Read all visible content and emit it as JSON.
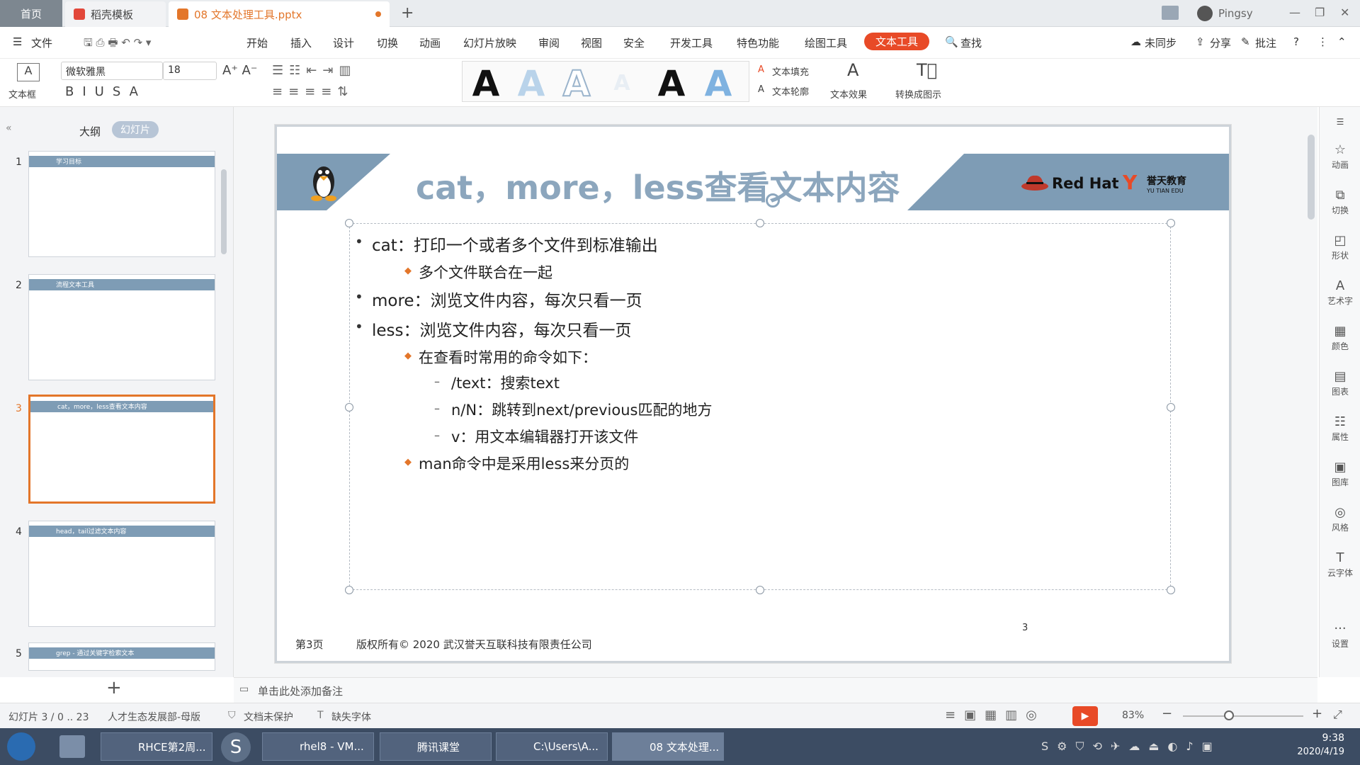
{
  "tabs": {
    "home": "首页",
    "template": "稻壳模板",
    "doc": "08 文本处理工具.pptx"
  },
  "user": "Pingsy",
  "menu": {
    "file": "文件",
    "items": [
      "开始",
      "插入",
      "设计",
      "切换",
      "动画",
      "幻灯片放映",
      "审阅",
      "视图",
      "安全",
      "开发工具",
      "特色功能",
      "绘图工具",
      "文本工具"
    ],
    "search": "查找",
    "sync": "未同步",
    "share": "分享",
    "comment": "批注"
  },
  "ribbon": {
    "textbox": "文本框",
    "font": "微软雅黑",
    "size": "18",
    "fill": "文本填充",
    "outline": "文本轮廓",
    "effect": "文本效果",
    "convert": "转换成图示",
    "artA": "A"
  },
  "panel": {
    "outline": "大纲",
    "slides": "幻灯片",
    "add": "+"
  },
  "thumbs": [
    {
      "n": "1",
      "title": "学习目标"
    },
    {
      "n": "2",
      "title": "流程文本工具"
    },
    {
      "n": "3",
      "title": "cat，more，less查看文本内容"
    },
    {
      "n": "4",
      "title": "head，tail过滤文本内容"
    },
    {
      "n": "5",
      "title": "grep - 通过关键字检索文本"
    }
  ],
  "slide": {
    "title": "cat，more，less查看文本内容",
    "brand": "Red Hat",
    "school": "誉天教育",
    "school_en": "YU TIAN EDU",
    "bullets": [
      {
        "level": 1,
        "text": "cat：打印一个或者多个文件到标准输出"
      },
      {
        "level": 2,
        "text": "多个文件联合在一起"
      },
      {
        "level": 1,
        "text": "more：浏览文件内容，每次只看一页"
      },
      {
        "level": 1,
        "text": "less：浏览文件内容，每次只看一页"
      },
      {
        "level": 2,
        "text": "在查看时常用的命令如下："
      },
      {
        "level": 3,
        "text": "/text：搜索text"
      },
      {
        "level": 3,
        "text": "n/N：跳转到next/previous匹配的地方"
      },
      {
        "level": 3,
        "text": "v：用文本编辑器打开该文件"
      },
      {
        "level": 2,
        "text": "man命令中是采用less来分页的"
      }
    ],
    "page_label": "第3页",
    "copyright": "版权所有© 2020 武汉誉天互联科技有限责任公司",
    "page_num": "3"
  },
  "notes": "单击此处添加备注",
  "status": {
    "slide": "幻灯片 3 / 0 .. 23",
    "theme": "人才生态发展部-母版",
    "protect": "文档未保护",
    "font": "缺失字体",
    "zoom": "83%"
  },
  "sidebar": [
    "动画",
    "切换",
    "形状",
    "艺术字",
    "颜色",
    "图表",
    "属性",
    "图库",
    "风格",
    "云字体",
    "设置"
  ],
  "taskbar": {
    "items": [
      "RHCE第2周...",
      "rhel8 - VM...",
      "腾讯课堂",
      "C:\\Users\\A...",
      "08 文本处理..."
    ],
    "time": "9:38",
    "date": "2020/4/19"
  },
  "colors": {
    "accent": "#e84a27",
    "slideBand": "#7e9cb5",
    "title": "#8ca6bd"
  }
}
